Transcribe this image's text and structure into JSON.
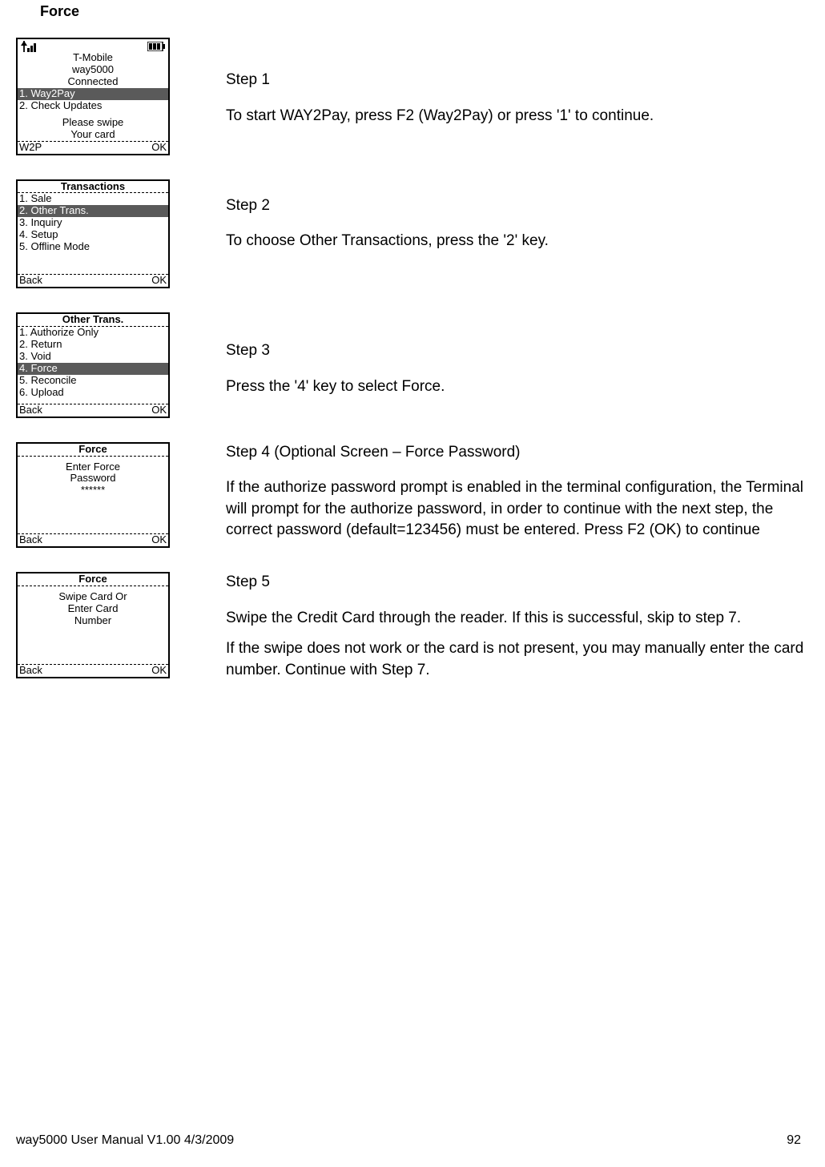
{
  "title": "Force",
  "footer": {
    "left": "way5000 User Manual V1.00     4/3/2009",
    "right": "92"
  },
  "steps": [
    {
      "label": "Step 1",
      "body": "To start WAY2Pay, press F2 (Way2Pay) or press '1' to continue."
    },
    {
      "label": "Step 2",
      "body": "To choose Other Transactions, press the '2' key."
    },
    {
      "label": "Step 3",
      "body": "Press the '4' key to select Force."
    },
    {
      "label": "Step 4 (Optional Screen – Force Password)",
      "body": "If the authorize password prompt is enabled in the terminal configuration, the Terminal will prompt for the authorize password, in order to continue with the next step, the correct password (default=123456) must be entered. Press F2 (OK) to continue"
    },
    {
      "label": "Step 5",
      "body": "Swipe the Credit Card through the reader.  If this is successful, skip to step 7.",
      "body2": "If the swipe does not work or the card is not present, you may manually enter the card number. Continue with Step 7."
    }
  ],
  "screens": {
    "s1": {
      "carrier": "T-Mobile",
      "device": "way5000",
      "status": "Connected",
      "items": [
        "1. Way2Pay",
        "2. Check Updates"
      ],
      "swipe1": "Please swipe",
      "swipe2": "Your card",
      "footLeft": "W2P",
      "footRight": "OK"
    },
    "s2": {
      "header": "Transactions",
      "items": [
        "1. Sale",
        "2. Other Trans.",
        "3. Inquiry",
        "4. Setup",
        "5. Offline Mode"
      ],
      "footLeft": "Back",
      "footRight": "OK"
    },
    "s3": {
      "header": "Other Trans.",
      "items": [
        "1. Authorize Only",
        "2. Return",
        "3. Void",
        "4. Force",
        "5. Reconcile",
        "6. Upload"
      ],
      "footLeft": "Back",
      "footRight": "OK"
    },
    "s4": {
      "header": "Force",
      "line1": "Enter Force",
      "line2": "Password",
      "line3": "******",
      "footLeft": "Back",
      "footRight": "OK"
    },
    "s5": {
      "header": "Force",
      "line1": "Swipe Card Or",
      "line2": "Enter Card",
      "line3": "Number",
      "footLeft": "Back",
      "footRight": "OK"
    }
  }
}
